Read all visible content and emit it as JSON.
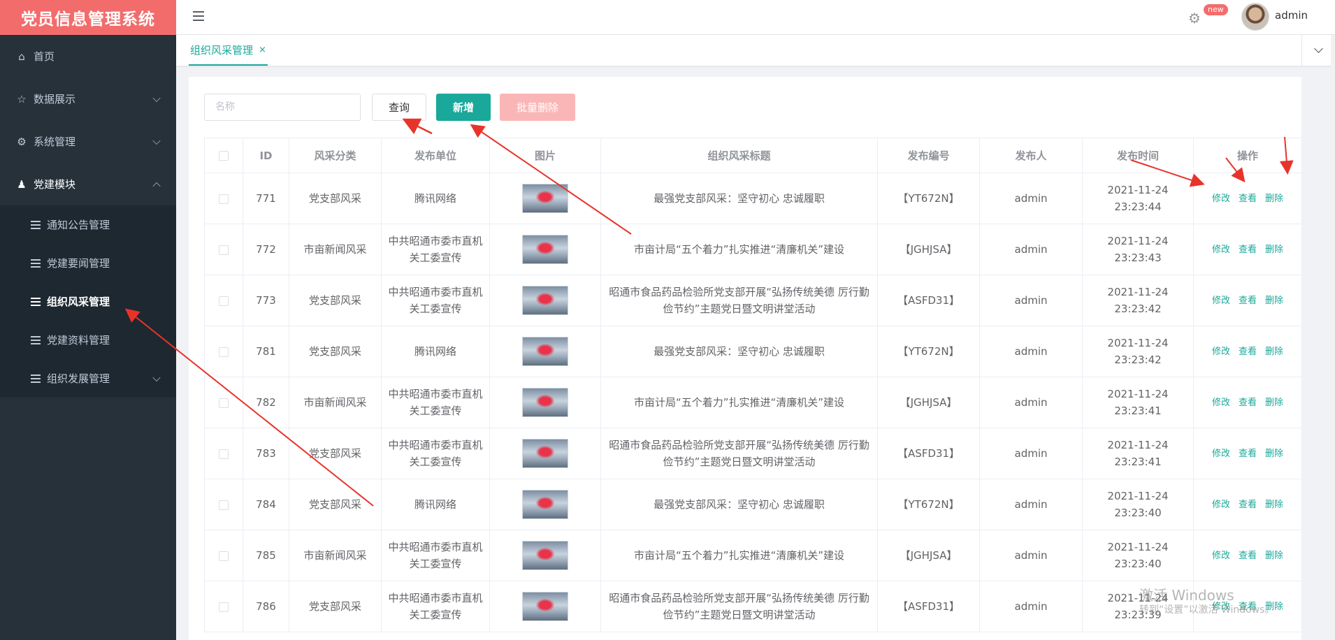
{
  "app_title": "党员信息管理系统",
  "sidebar": {
    "items": [
      {
        "label": "首页",
        "icon": "home-icon",
        "has_arrow": false
      },
      {
        "label": "数据展示",
        "icon": "star-icon",
        "has_arrow": true
      },
      {
        "label": "系统管理",
        "icon": "gear-icon",
        "has_arrow": true
      },
      {
        "label": "党建模块",
        "icon": "user-icon",
        "has_arrow": true,
        "expanded": true
      }
    ],
    "sub_items": [
      {
        "label": "通知公告管理"
      },
      {
        "label": "党建要闻管理"
      },
      {
        "label": "组织风采管理",
        "active": true
      },
      {
        "label": "党建资料管理"
      },
      {
        "label": "组织发展管理",
        "has_arrow": true
      }
    ]
  },
  "header": {
    "badge": "new",
    "username": "admin"
  },
  "tabs": [
    {
      "label": "组织风采管理",
      "close": "×"
    }
  ],
  "toolbar": {
    "search_placeholder": "名称",
    "query_label": "查询",
    "add_label": "新增",
    "batch_delete_label": "批量删除"
  },
  "table": {
    "headers": [
      "ID",
      "风采分类",
      "发布单位",
      "图片",
      "组织风采标题",
      "发布编号",
      "发布人",
      "发布时间",
      "操作"
    ],
    "rows": [
      {
        "id": "771",
        "category": "党支部风采",
        "unit": "腾讯网络",
        "title": "最强党支部风采：坚守初心 忠诚履职",
        "code": "【YT672N】",
        "publisher": "admin",
        "time": "2021-11-24 23:23:44"
      },
      {
        "id": "772",
        "category": "市亩新闻风采",
        "unit": "中共昭通市委市直机关工委宣传",
        "title": "市亩计局“五个着力”扎实推进“清廉机关”建设",
        "code": "【JGHJSA】",
        "publisher": "admin",
        "time": "2021-11-24 23:23:43"
      },
      {
        "id": "773",
        "category": "党支部风采",
        "unit": "中共昭通市委市直机关工委宣传",
        "title": "昭通市食品药品检验所党支部开展“弘扬传统美德 厉行勤俭节约”主题党日暨文明讲堂活动",
        "code": "【ASFD31】",
        "publisher": "admin",
        "time": "2021-11-24 23:23:42"
      },
      {
        "id": "781",
        "category": "党支部风采",
        "unit": "腾讯网络",
        "title": "最强党支部风采：坚守初心 忠诚履职",
        "code": "【YT672N】",
        "publisher": "admin",
        "time": "2021-11-24 23:23:42"
      },
      {
        "id": "782",
        "category": "市亩新闻风采",
        "unit": "中共昭通市委市直机关工委宣传",
        "title": "市亩计局“五个着力”扎实推进“清廉机关”建设",
        "code": "【JGHJSA】",
        "publisher": "admin",
        "time": "2021-11-24 23:23:41"
      },
      {
        "id": "783",
        "category": "党支部风采",
        "unit": "中共昭通市委市直机关工委宣传",
        "title": "昭通市食品药品检验所党支部开展“弘扬传统美德 厉行勤俭节约”主题党日暨文明讲堂活动",
        "code": "【ASFD31】",
        "publisher": "admin",
        "time": "2021-11-24 23:23:41"
      },
      {
        "id": "784",
        "category": "党支部风采",
        "unit": "腾讯网络",
        "title": "最强党支部风采：坚守初心 忠诚履职",
        "code": "【YT672N】",
        "publisher": "admin",
        "time": "2021-11-24 23:23:40"
      },
      {
        "id": "785",
        "category": "市亩新闻风采",
        "unit": "中共昭通市委市直机关工委宣传",
        "title": "市亩计局“五个着力”扎实推进“清廉机关”建设",
        "code": "【JGHJSA】",
        "publisher": "admin",
        "time": "2021-11-24 23:23:40"
      },
      {
        "id": "786",
        "category": "党支部风采",
        "unit": "中共昭通市委市直机关工委宣传",
        "title": "昭通市食品药品检验所党支部开展“弘扬传统美德 厉行勤俭节约”主题党日暨文明讲堂活动",
        "code": "【ASFD31】",
        "publisher": "admin",
        "time": "2021-11-24 23:23:39"
      }
    ],
    "actions": {
      "edit": "修改",
      "view": "查看",
      "delete": "删除"
    }
  },
  "watermark": {
    "line1": "激活 Windows",
    "line2": "转到“设置”以激活 Windows。"
  },
  "colors": {
    "brand": "#1aa89a",
    "logo_bg": "#f26c6c",
    "sidebar_bg": "#26313a",
    "arrow": "#e8332b"
  }
}
